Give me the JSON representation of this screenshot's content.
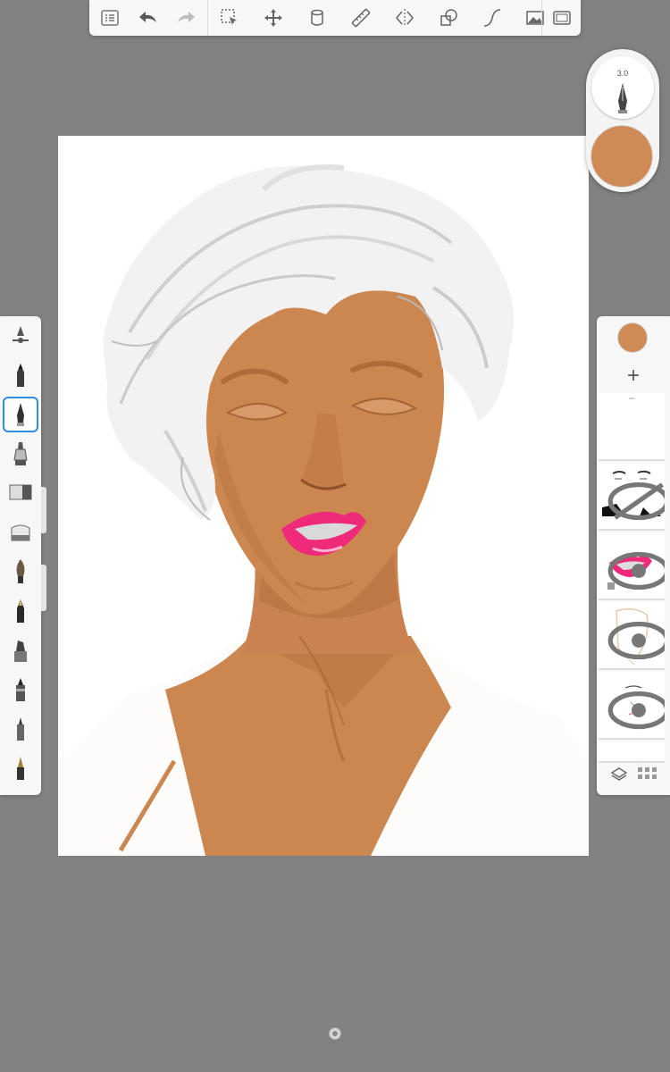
{
  "toolbar": {
    "items": [
      {
        "name": "layers-list-icon"
      },
      {
        "name": "undo-icon"
      },
      {
        "name": "redo-icon"
      },
      {
        "name": "selection-icon"
      },
      {
        "name": "transform-icon"
      },
      {
        "name": "fill-bucket-icon"
      },
      {
        "name": "ruler-icon"
      },
      {
        "name": "symmetry-icon"
      },
      {
        "name": "shapes-icon"
      },
      {
        "name": "curve-icon"
      },
      {
        "name": "image-icon"
      },
      {
        "name": "fullscreen-icon"
      }
    ]
  },
  "brush_puck": {
    "size_label": "3.0",
    "color": "#cf8a55"
  },
  "brushes": [
    {
      "name": "brush-properties"
    },
    {
      "name": "pencil-brush"
    },
    {
      "name": "ink-pen-brush"
    },
    {
      "name": "airbrush-brush"
    },
    {
      "name": "marker-brush"
    },
    {
      "name": "eraser-brush"
    },
    {
      "name": "paint-brush"
    },
    {
      "name": "charcoal-brush"
    },
    {
      "name": "chisel-marker-brush"
    },
    {
      "name": "felt-pen-brush"
    },
    {
      "name": "fineliner-brush"
    },
    {
      "name": "calligraphy-pen-brush"
    }
  ],
  "layers": {
    "active_color": "#cf8a55",
    "add_label": "+",
    "thumbnails": [
      {
        "name": "layer-1"
      },
      {
        "name": "layer-2"
      },
      {
        "name": "layer-3"
      },
      {
        "name": "layer-4"
      },
      {
        "name": "layer-5"
      },
      {
        "name": "layer-6"
      }
    ]
  },
  "colors": {
    "skin": "#cf8a55",
    "lips": "#f02a7a",
    "hair": "#f2f2f2",
    "background": "#818181"
  }
}
